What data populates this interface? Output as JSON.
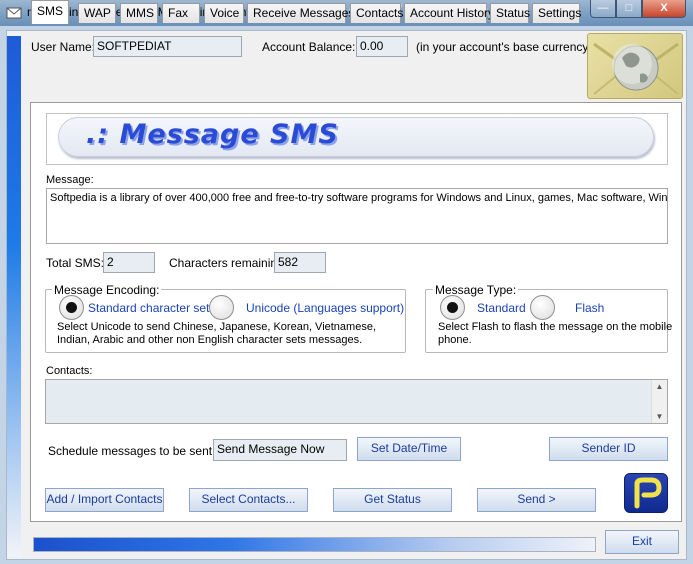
{
  "window": {
    "title": "messagingPeople(TM) : Messaging Client v2.13",
    "watermark": "SOFTPEDIA",
    "min_glyph": "—",
    "max_glyph": "□",
    "close_glyph": "X"
  },
  "account": {
    "user_label": "User Name:",
    "user_value": "SOFTPEDIAT",
    "balance_label": "Account Balance:",
    "balance_value": "0.00",
    "currency_note": "(in your account's base currency)"
  },
  "tabs": [
    {
      "label": "SMS",
      "active": true
    },
    {
      "label": "WAP"
    },
    {
      "label": "MMS"
    },
    {
      "label": "Fax"
    },
    {
      "label": "Voice"
    },
    {
      "label": "Receive Messages"
    },
    {
      "label": "Contacts"
    },
    {
      "label": "Account History"
    },
    {
      "label": "Status"
    },
    {
      "label": "Settings"
    }
  ],
  "sms": {
    "banner": ".: Message SMS",
    "message_label": "Message:",
    "message_text": "Softpedia is a library of over 400,000 free and free-to-try software programs for Windows and Linux, games, Mac software, Windows",
    "total_sms_label": "Total SMS:",
    "total_sms_value": "2",
    "chars_remaining_label": "Characters remaining:",
    "chars_remaining_value": "582",
    "encoding": {
      "title": "Message Encoding:",
      "option_standard": "Standard character set",
      "option_unicode": "Unicode (Languages support)",
      "selected": "standard",
      "description_line1": "Select Unicode to send Chinese, Japanese, Korean, Vietnamese,",
      "description_line2": "Indian, Arabic and other non English character sets messages."
    },
    "type": {
      "title": "Message Type:",
      "option_standard": "Standard",
      "option_flash": "Flash",
      "selected": "standard",
      "description_line1": "Select Flash to flash the message on the mobile",
      "description_line2": "phone."
    },
    "contacts_label": "Contacts:",
    "schedule_label": "Schedule messages to be sent at:",
    "schedule_value": "Send Message Now",
    "set_date_button": "Set Date/Time",
    "sender_id_button": "Sender ID"
  },
  "actions": {
    "add_import": "Add / Import Contacts",
    "select_contacts": "Select Contacts...",
    "get_status": "Get Status",
    "send": "Send >",
    "exit": "Exit"
  },
  "progress": 0.8,
  "colors": {
    "accent_blue": "#1b43b9",
    "title_bar": "#7ea1c4",
    "close_red": "#c7442b",
    "logo_navy": "#1a3aa6"
  }
}
